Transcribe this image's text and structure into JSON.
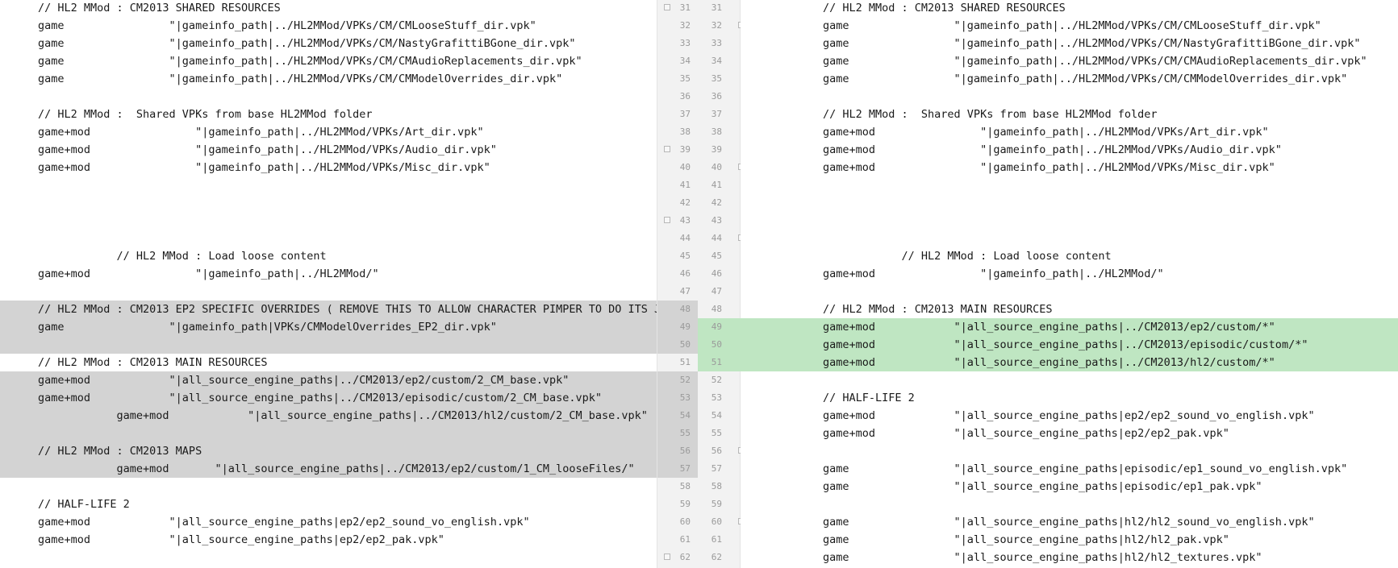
{
  "lines": [
    {
      "ln": "31",
      "rn": "31",
      "left": "// HL2 MMod : CM2013 SHARED RESOURCES",
      "right": "// HL2 MMod : CM2013 SHARED RESOURCES",
      "foldL": true,
      "foldR": false
    },
    {
      "ln": "32",
      "rn": "32",
      "left": "game                \"|gameinfo_path|../HL2MMod/VPKs/CM/CMLooseStuff_dir.vpk\"",
      "right": "game                \"|gameinfo_path|../HL2MMod/VPKs/CM/CMLooseStuff_dir.vpk\"",
      "foldL": false,
      "foldR": true
    },
    {
      "ln": "33",
      "rn": "33",
      "left": "game                \"|gameinfo_path|../HL2MMod/VPKs/CM/NastyGrafittiBGone_dir.vpk\"",
      "right": "game                \"|gameinfo_path|../HL2MMod/VPKs/CM/NastyGrafittiBGone_dir.vpk\""
    },
    {
      "ln": "34",
      "rn": "34",
      "left": "game                \"|gameinfo_path|../HL2MMod/VPKs/CM/CMAudioReplacements_dir.vpk\"",
      "right": "game                \"|gameinfo_path|../HL2MMod/VPKs/CM/CMAudioReplacements_dir.vpk\""
    },
    {
      "ln": "35",
      "rn": "35",
      "left": "game                \"|gameinfo_path|../HL2MMod/VPKs/CM/CMModelOverrides_dir.vpk\"",
      "right": "game                \"|gameinfo_path|../HL2MMod/VPKs/CM/CMModelOverrides_dir.vpk\""
    },
    {
      "ln": "36",
      "rn": "36",
      "left": "",
      "right": ""
    },
    {
      "ln": "37",
      "rn": "37",
      "left": "// HL2 MMod :  Shared VPKs from base HL2MMod folder",
      "right": "// HL2 MMod :  Shared VPKs from base HL2MMod folder"
    },
    {
      "ln": "38",
      "rn": "38",
      "left": "game+mod                \"|gameinfo_path|../HL2MMod/VPKs/Art_dir.vpk\"",
      "right": "game+mod                \"|gameinfo_path|../HL2MMod/VPKs/Art_dir.vpk\""
    },
    {
      "ln": "39",
      "rn": "39",
      "left": "game+mod                \"|gameinfo_path|../HL2MMod/VPKs/Audio_dir.vpk\"",
      "right": "game+mod                \"|gameinfo_path|../HL2MMod/VPKs/Audio_dir.vpk\"",
      "foldL": true
    },
    {
      "ln": "40",
      "rn": "40",
      "left": "game+mod                \"|gameinfo_path|../HL2MMod/VPKs/Misc_dir.vpk\"",
      "right": "game+mod                \"|gameinfo_path|../HL2MMod/VPKs/Misc_dir.vpk\"",
      "foldR": true
    },
    {
      "ln": "41",
      "rn": "41",
      "left": "",
      "right": ""
    },
    {
      "ln": "42",
      "rn": "42",
      "left": "",
      "right": ""
    },
    {
      "ln": "43",
      "rn": "43",
      "left": "",
      "right": "",
      "foldL": true
    },
    {
      "ln": "44",
      "rn": "44",
      "left": "",
      "right": "",
      "foldR": true
    },
    {
      "ln": "45",
      "rn": "45",
      "left": "            // HL2 MMod : Load loose content",
      "right": "            // HL2 MMod : Load loose content"
    },
    {
      "ln": "46",
      "rn": "46",
      "left": "game+mod                \"|gameinfo_path|../HL2MMod/\"",
      "right": "game+mod                \"|gameinfo_path|../HL2MMod/\""
    },
    {
      "ln": "47",
      "rn": "47",
      "left": "",
      "right": ""
    },
    {
      "ln": "48",
      "rn": "48",
      "left": "// HL2 MMod : CM2013 EP2 SPECIFIC OVERRIDES ( REMOVE THIS TO ALLOW CHARACTER PIMPER TO DO ITS J",
      "right": "// HL2 MMod : CM2013 MAIN RESOURCES",
      "typeL": "removed"
    },
    {
      "ln": "49",
      "rn": "49",
      "left": "game                \"|gameinfo_path|VPKs/CMModelOverrides_EP2_dir.vpk\"",
      "right": "game+mod            \"|all_source_engine_paths|../CM2013/ep2/custom/*\"",
      "typeL": "removed",
      "typeR": "added"
    },
    {
      "ln": "50",
      "rn": "50",
      "left": "",
      "right": "game+mod            \"|all_source_engine_paths|../CM2013/episodic/custom/*\"",
      "typeL": "removed",
      "typeR": "added"
    },
    {
      "ln": "51",
      "rn": "51",
      "left": "// HL2 MMod : CM2013 MAIN RESOURCES",
      "right": "game+mod            \"|all_source_engine_paths|../CM2013/hl2/custom/*\"",
      "typeR": "added"
    },
    {
      "ln": "52",
      "rn": "52",
      "left": "game+mod            \"|all_source_engine_paths|../CM2013/ep2/custom/2_CM_base.vpk\"",
      "right": "",
      "typeL": "removed"
    },
    {
      "ln": "53",
      "rn": "53",
      "left": "game+mod            \"|all_source_engine_paths|../CM2013/episodic/custom/2_CM_base.vpk\"",
      "right": "// HALF-LIFE 2",
      "typeL": "removed"
    },
    {
      "ln": "54",
      "rn": "54",
      "left": "            game+mod            \"|all_source_engine_paths|../CM2013/hl2/custom/2_CM_base.vpk\"",
      "right": "game+mod            \"|all_source_engine_paths|ep2/ep2_sound_vo_english.vpk\"",
      "typeL": "removed"
    },
    {
      "ln": "55",
      "rn": "55",
      "left": "",
      "right": "game+mod            \"|all_source_engine_paths|ep2/ep2_pak.vpk\"",
      "typeL": "removed"
    },
    {
      "ln": "56",
      "rn": "56",
      "left": "// HL2 MMod : CM2013 MAPS",
      "right": "",
      "typeL": "removed",
      "foldR": true
    },
    {
      "ln": "57",
      "rn": "57",
      "left": "            game+mod       \"|all_source_engine_paths|../CM2013/ep2/custom/1_CM_looseFiles/\"",
      "right": "game                \"|all_source_engine_paths|episodic/ep1_sound_vo_english.vpk\"",
      "typeL": "removed"
    },
    {
      "ln": "58",
      "rn": "58",
      "left": "",
      "right": "game                \"|all_source_engine_paths|episodic/ep1_pak.vpk\""
    },
    {
      "ln": "59",
      "rn": "59",
      "left": "// HALF-LIFE 2",
      "right": ""
    },
    {
      "ln": "60",
      "rn": "60",
      "left": "game+mod            \"|all_source_engine_paths|ep2/ep2_sound_vo_english.vpk\"",
      "right": "game                \"|all_source_engine_paths|hl2/hl2_sound_vo_english.vpk\"",
      "foldR": true
    },
    {
      "ln": "61",
      "rn": "61",
      "left": "game+mod            \"|all_source_engine_paths|ep2/ep2_pak.vpk\"",
      "right": "game                \"|all_source_engine_paths|hl2/hl2_pak.vpk\""
    },
    {
      "ln": "62",
      "rn": "62",
      "left": "",
      "right": "game                \"|all_source_engine_paths|hl2/hl2_textures.vpk\"",
      "foldL": true
    }
  ]
}
